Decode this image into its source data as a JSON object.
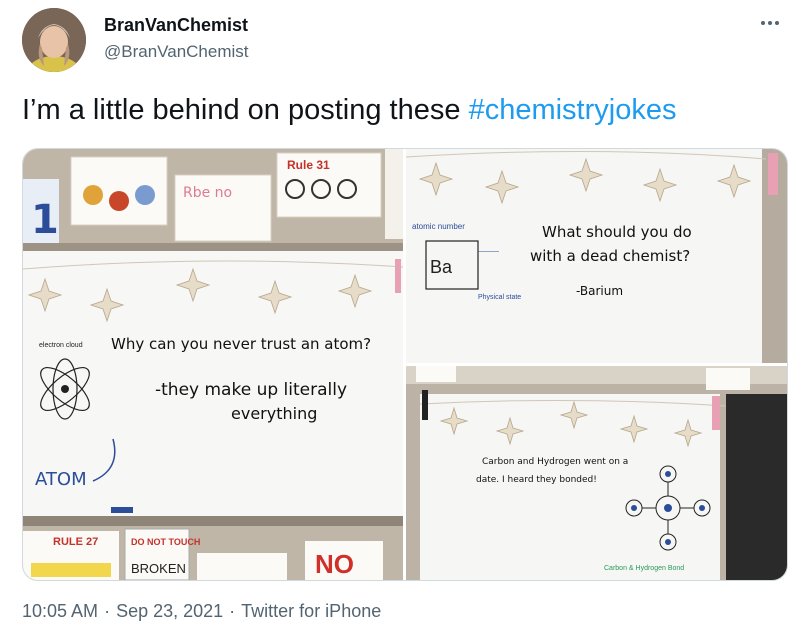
{
  "user": {
    "display_name": "BranVanChemist",
    "handle": "@BranVanChemist"
  },
  "tweet": {
    "text_prefix": "I’m a little behind on posting these ",
    "hashtag": "#chemistryjokes"
  },
  "photos": {
    "left": {
      "joke_line1": "Why can you never trust an atom?",
      "answer_line1": "-they make up literally",
      "answer_line2": "everything",
      "atom_label": "ATOM",
      "poster_rule31": "Rule 31",
      "poster_rule27": "RULE 27",
      "poster_do_not_touch": "DO NOT TOUCH",
      "poster_broken": "BROKEN",
      "poster_no": "NO"
    },
    "top_right": {
      "joke_line1": "What should you do",
      "joke_line2": "with a dead chemist?",
      "answer": "-Barium",
      "element_symbol": "Ba",
      "atomic_number_label": "atomic number"
    },
    "bottom_right": {
      "joke_line1": "Carbon and Hydrogen went on a",
      "joke_line2": "date. I heard they bonded!",
      "diagram_caption": "Carbon & Hydrogen Bond"
    }
  },
  "footer": {
    "time": "10:05 AM",
    "date": "Sep 23, 2021",
    "source": "Twitter for iPhone"
  },
  "colors": {
    "accent": "#1d9bf0",
    "text_primary": "#0f1419",
    "text_secondary": "#536471"
  }
}
